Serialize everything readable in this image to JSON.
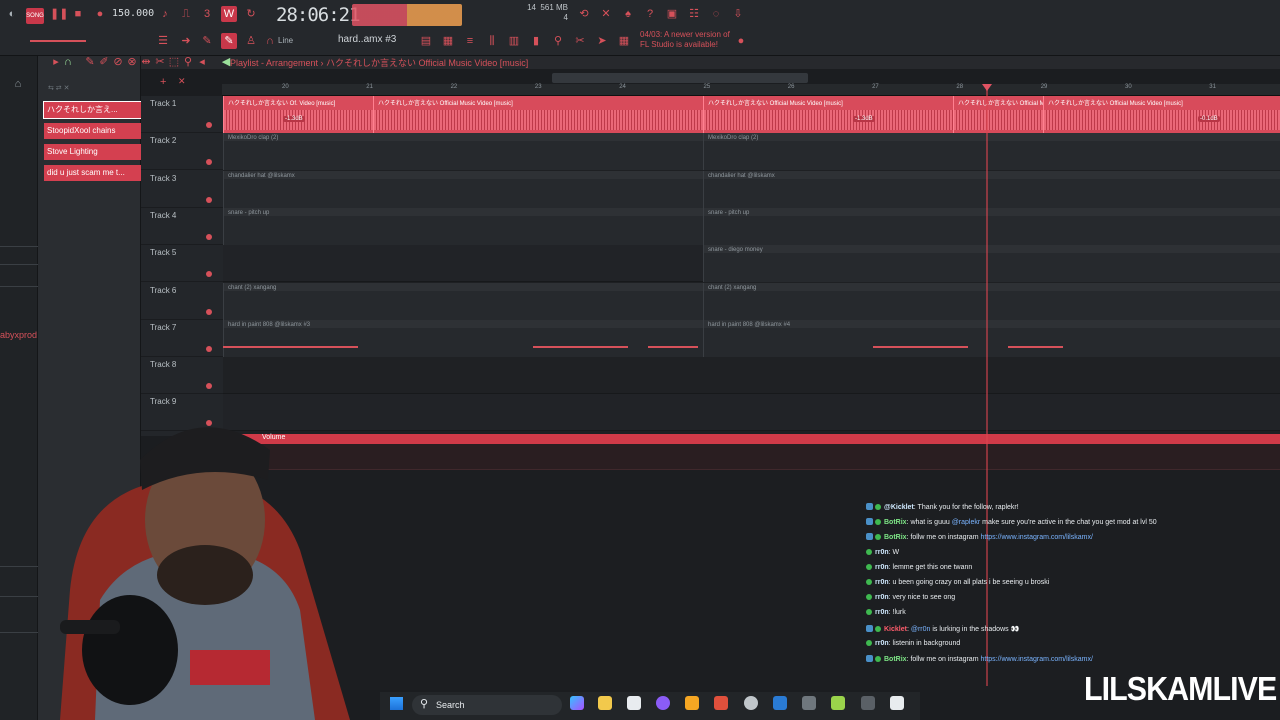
{
  "toolbar": {
    "song_label": "SONG",
    "bpm": "150.000",
    "time": "28:06:21",
    "cpu_top": "14",
    "memory": "561 MB",
    "cpu_bottom": "4",
    "pattern_name": "hard..amx #3",
    "snap_label": "Line",
    "news": "04/03: A newer version of FL Studio is available!"
  },
  "playlist": {
    "title": "Playlist - Arrangement",
    "subtitle": "ハクそれしか言えない Official Music Video [music]",
    "ruler": [
      "20",
      "21",
      "22",
      "23",
      "24",
      "25",
      "26",
      "27",
      "28",
      "29",
      "30",
      "31"
    ]
  },
  "picker": {
    "items": [
      {
        "label": "ハクそれしか言え..."
      },
      {
        "label": "StoopidXool chains"
      },
      {
        "label": "Stove Lighting"
      },
      {
        "label": "did u just scam me t..."
      }
    ]
  },
  "sidebar_name": "abyxprod",
  "tracks": [
    {
      "name": "Track 1",
      "clips": [
        {
          "label": "ハクそれしか言えない Of. Video [music]"
        },
        {
          "label": "ハクそれしか言えない Official Music Video [music]"
        },
        {
          "label": "ハクそれしか言えない Official Music Video [music]"
        },
        {
          "label": "ハクそれしか言えない Official Music Video [music]"
        },
        {
          "label": "ハクそれしか言えない Official Music Video [music]"
        }
      ],
      "gains": [
        "-1.3dB",
        "-1.3dB",
        "-0.1dB"
      ]
    },
    {
      "name": "Track 2",
      "clips": [
        {
          "label": "MexikoDro clap (2)"
        },
        {
          "label": "MexikoDro clap (2)"
        }
      ]
    },
    {
      "name": "Track 3",
      "clips": [
        {
          "label": "chandalier hat @lilskamx"
        },
        {
          "label": "chandalier hat @lilskamx"
        }
      ]
    },
    {
      "name": "Track 4",
      "clips": [
        {
          "label": "snare - pitch up"
        },
        {
          "label": "snare - pitch up"
        }
      ]
    },
    {
      "name": "Track 5",
      "clips": [
        {
          "label": "snare - diego money"
        }
      ]
    },
    {
      "name": "Track 6",
      "clips": [
        {
          "label": "chant (2) xangang"
        },
        {
          "label": "chant (2) xangang"
        }
      ]
    },
    {
      "name": "Track 7",
      "clips": [
        {
          "label": "hard in paint 808 @lilskamx #3"
        },
        {
          "label": "hard in paint 808 @lilskamx #4"
        }
      ]
    },
    {
      "name": "Track 8",
      "clips": []
    },
    {
      "name": "Track 9",
      "clips": []
    }
  ],
  "automation": {
    "label": "Volume"
  },
  "chat": [
    {
      "user": "@Kicklet",
      "text": ": Thank you for the follow, raplekr!",
      "badge": true
    },
    {
      "user": "BotRix",
      "text": ": what is guuu ",
      "mention": "@raplekr",
      "text2": " make sure you're active in the chat you get mod at lvl 50",
      "badge": true
    },
    {
      "user": "BotRix",
      "text": ": follw me on instagram ",
      "link": "https://www.instagram.com/lilskamx/",
      "badge": true
    },
    {
      "user": "rr0n",
      "text": ": W"
    },
    {
      "user": "rr0n",
      "text": ": lemme get this one twann"
    },
    {
      "user": "rr0n",
      "text": ": u been going crazy on all plats i be seeing u broski"
    },
    {
      "user": "rr0n",
      "text": ": very nice to see ong"
    },
    {
      "user": "rr0n",
      "text": ": !lurk"
    },
    {
      "user": "Kicklet",
      "text": ": ",
      "mention": "@rr0n",
      "text2": " is lurking in the shadows 👀",
      "badge": true
    },
    {
      "user": "rr0n",
      "text": ": listenin in background"
    },
    {
      "user": "BotRix",
      "text": ": follw me on instagram ",
      "link": "https://www.instagram.com/lilskamx/",
      "badge": true
    }
  ],
  "taskbar": {
    "search": "Search"
  },
  "brand": "LILSKAMLIVE",
  "colors": {
    "accent": "#d6515a",
    "audio_clip": "#d84b5b",
    "chat_link": "#7ab4ff",
    "taskbar": "#222528"
  }
}
